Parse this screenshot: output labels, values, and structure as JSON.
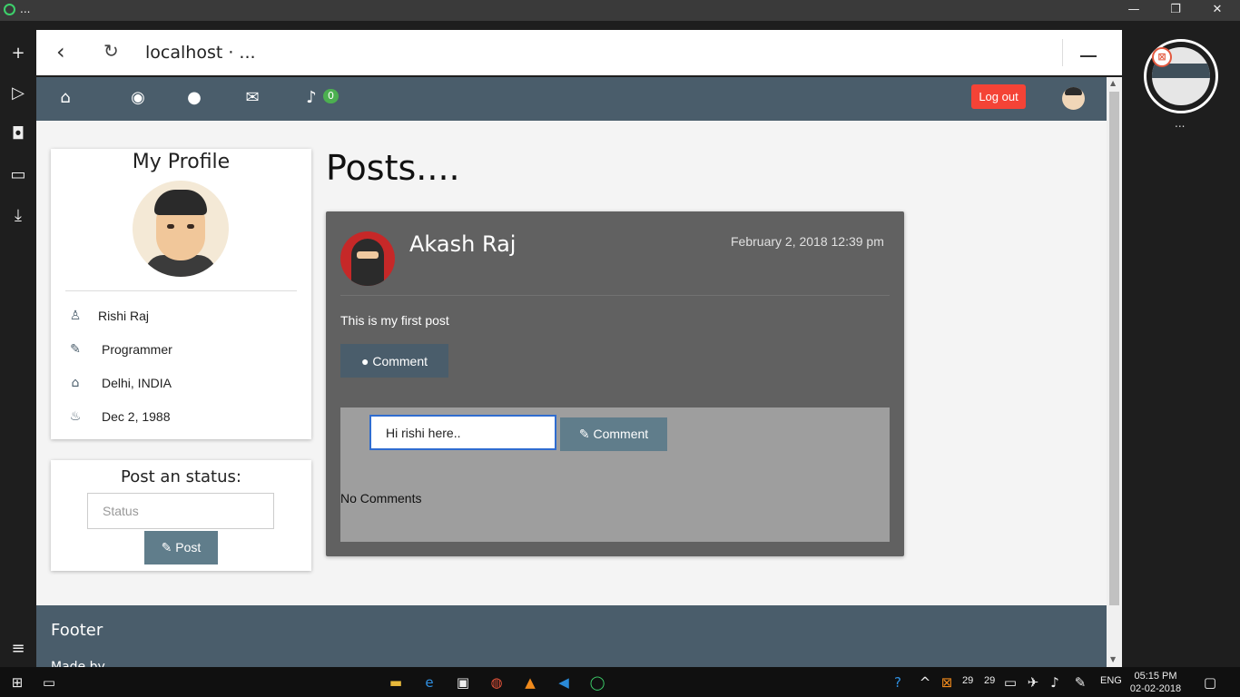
{
  "window": {
    "title": "...",
    "minimize": "—",
    "restore": "❐",
    "close": "✕"
  },
  "browser": {
    "url": "localhost · ...",
    "dial_dots": "..."
  },
  "nav": {
    "notif_count": "0",
    "logout": "Log out"
  },
  "profile": {
    "title": "My Profile",
    "name": "Rishi Raj",
    "occupation": "Programmer",
    "location": "Delhi, INDIA",
    "birthday": "Dec 2, 1988"
  },
  "status": {
    "title": "Post an status:",
    "placeholder": "Status",
    "post_label": "Post"
  },
  "posts": {
    "heading": "Posts....",
    "items": [
      {
        "author": "Akash Raj",
        "date": "February 2, 2018 12:39 pm",
        "text": "This is my first post",
        "comment_button": "Comment",
        "comment_input_value": "Hi rishi here..",
        "comment_submit": "Comment",
        "comments_empty": "No Comments"
      }
    ]
  },
  "footer": {
    "title": "Footer",
    "made": "Made by"
  },
  "taskbar": {
    "temp1": "29",
    "temp2": "29",
    "lang": "ENG",
    "time": "05:15 PM",
    "date": "02-02-2018"
  },
  "colors": {
    "nav_bg": "#4a5d6b",
    "logout_bg": "#f44336",
    "post_bg": "#616161",
    "accent": "#607d8b"
  }
}
